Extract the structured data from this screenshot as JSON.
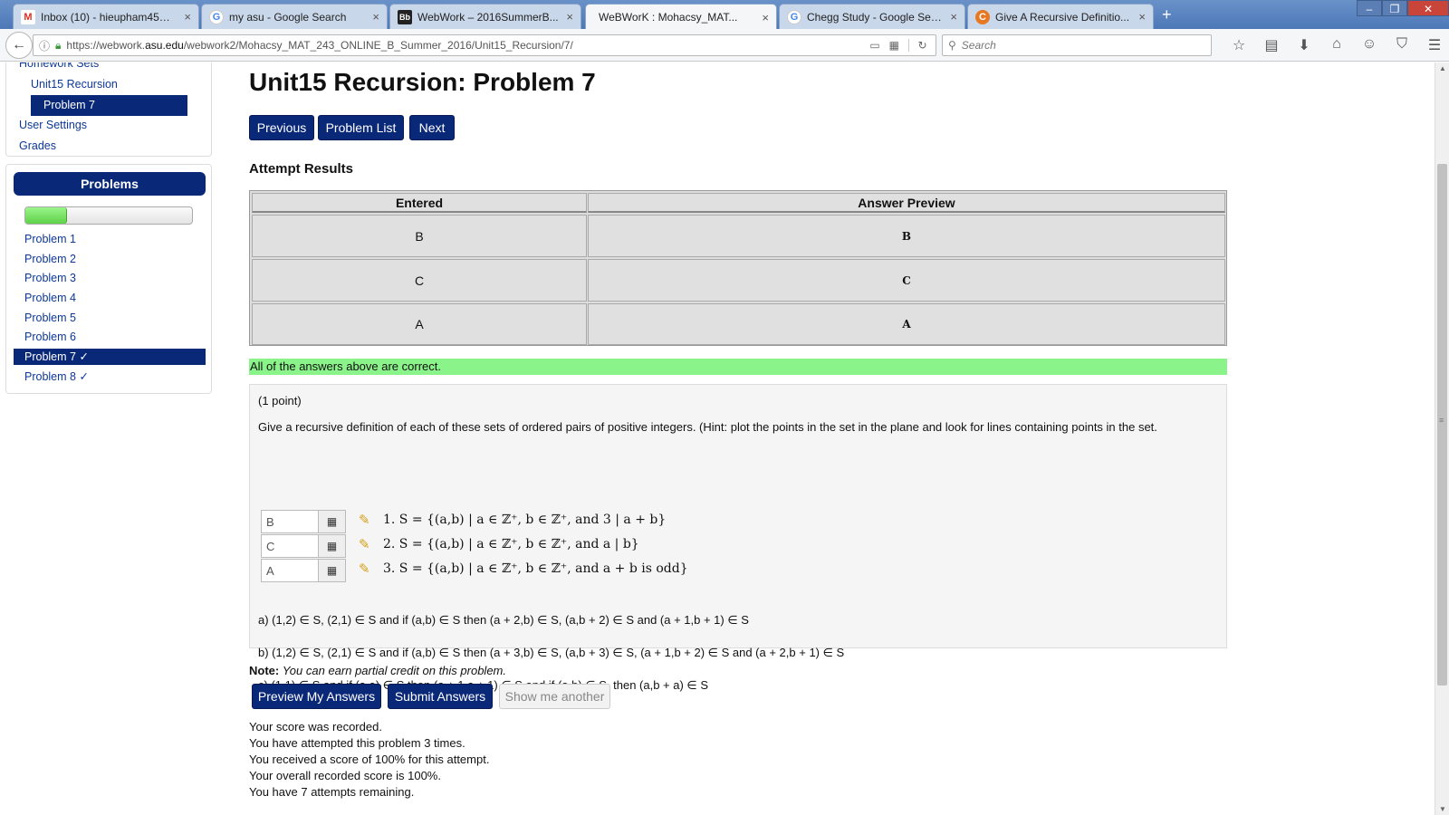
{
  "browser": {
    "tabs": [
      {
        "title": "Inbox (10) - hieupham45@...",
        "icon": "gmail-icon"
      },
      {
        "title": "my asu - Google Search",
        "icon": "google-icon"
      },
      {
        "title": "WebWork – 2016SummerB...",
        "icon": "blackboard-icon"
      },
      {
        "title": "WeBWorK : Mohacsy_MAT...",
        "icon": "webwork-icon"
      },
      {
        "title": "Chegg Study - Google Sear...",
        "icon": "google-icon"
      },
      {
        "title": "Give A Recursive Definitio...",
        "icon": "chegg-icon"
      }
    ],
    "url_prefix": "https://webwork.",
    "url_domain": "asu.edu",
    "url_path": "/webwork2/Mohacsy_MAT_243_ONLINE_B_Summer_2016/Unit15_Recursion/7/",
    "search_placeholder": "Search"
  },
  "sidebar": {
    "homework_sets": "Homework Sets",
    "set_name": "Unit15 Recursion",
    "current_problem": "Problem 7",
    "user_settings": "User Settings",
    "grades": "Grades",
    "problems_header": "Problems",
    "progress_fraction": 0.25,
    "problems": [
      {
        "label": "Problem 1"
      },
      {
        "label": "Problem 2"
      },
      {
        "label": "Problem 3"
      },
      {
        "label": "Problem 4"
      },
      {
        "label": "Problem 5"
      },
      {
        "label": "Problem 6"
      },
      {
        "label": "Problem 7 ✓"
      },
      {
        "label": "Problem 8 ✓"
      }
    ]
  },
  "main": {
    "title": "Unit15 Recursion: Problem 7",
    "nav_buttons": {
      "previous": "Previous",
      "problem_list": "Problem List",
      "next": "Next"
    },
    "attempt_results_heading": "Attempt Results",
    "results_headers": {
      "entered": "Entered",
      "preview": "Answer Preview"
    },
    "results_rows": [
      {
        "entered": "B",
        "preview": "B"
      },
      {
        "entered": "C",
        "preview": "C"
      },
      {
        "entered": "A",
        "preview": "A"
      }
    ],
    "correct_message": "All of the answers above are correct.",
    "points": "(1 point)",
    "question": "Give a recursive definition of each of these sets of ordered pairs of positive integers. (Hint: plot the points in the set in the plane and look for lines containing points in the set.",
    "answers": [
      {
        "value": "B",
        "math": "1.  S = {(a,b) | a ∈ ℤ⁺, b ∈ ℤ⁺, and 3 | a + b}"
      },
      {
        "value": "C",
        "math": "2.  S = {(a,b) | a ∈ ℤ⁺, b ∈ ℤ⁺, and a | b}"
      },
      {
        "value": "A",
        "math": "3.  S = {(a,b) | a ∈ ℤ⁺, b ∈ ℤ⁺, and a + b is odd}"
      }
    ],
    "choices": [
      "a) (1,2) ∈ S, (2,1) ∈ S and if (a,b) ∈ S then (a + 2,b) ∈ S, (a,b + 2) ∈ S and (a + 1,b + 1) ∈ S",
      "b)  (1,2) ∈ S, (2,1) ∈ S and if (a,b) ∈ S then (a + 3,b) ∈ S, (a,b + 3) ∈ S, (a + 1,b + 2) ∈ S and (a + 2,b + 1) ∈ S",
      "c)  (1,1) ∈ S and if (a,a) ∈ S then (a + 1,a + 1) ∈ S and if (a,b) ∈ S, then (a,b + a) ∈ S"
    ],
    "note_label": "Note:",
    "note_text": "You can earn partial credit on this problem.",
    "buttons": {
      "preview": "Preview My Answers",
      "submit": "Submit Answers",
      "another": "Show me another"
    },
    "score_lines": [
      "Your score was recorded.",
      "You have attempted this problem 3 times.",
      "You received a score of 100% for this attempt.",
      "Your overall recorded score is 100%.",
      "You have 7 attempts remaining."
    ]
  }
}
